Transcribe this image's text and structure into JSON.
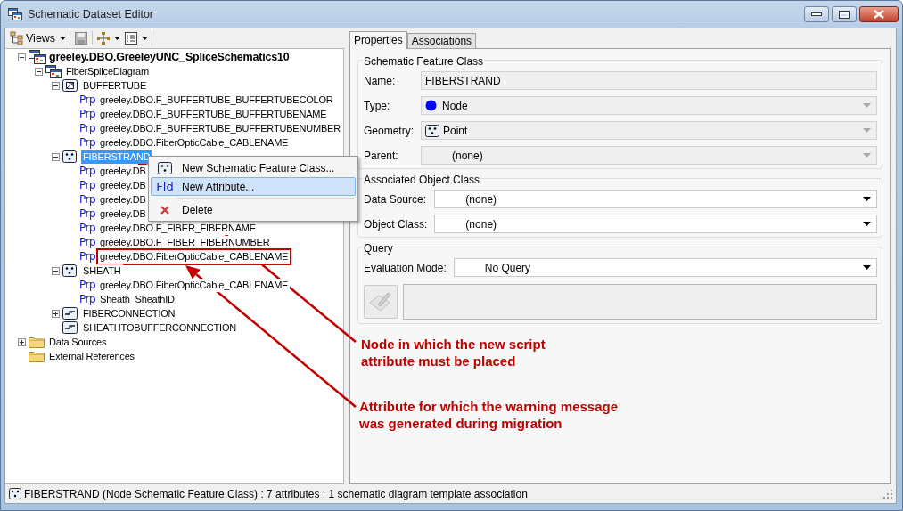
{
  "window": {
    "title": "Schematic Dataset Editor"
  },
  "toolbar": {
    "views_label": "Views"
  },
  "tree": [
    {
      "kind": "dataset",
      "label": "greeley.DBO.GreeleyUNC_SpliceSchematics10",
      "expanded": true,
      "selected": false,
      "children": [
        {
          "kind": "diagram",
          "label": "FiberSpliceDiagram",
          "expanded": true,
          "selected": false,
          "children": [
            {
              "kind": "container_class",
              "label": "BUFFERTUBE",
              "expanded": true,
              "selected": false,
              "children": [
                {
                  "kind": "property",
                  "tag": "Prp",
                  "label": "greeley.DBO.F_BUFFERTUBE_BUFFERTUBECOLOR",
                  "selected": false,
                  "outlined": false
                },
                {
                  "kind": "property",
                  "tag": "Prp",
                  "label": "greeley.DBO.F_BUFFERTUBE_BUFFERTUBENAME",
                  "selected": false,
                  "outlined": false
                },
                {
                  "kind": "property",
                  "tag": "Prp",
                  "label": "greeley.DBO.F_BUFFERTUBE_BUFFERTUBENUMBER",
                  "selected": false,
                  "outlined": false
                },
                {
                  "kind": "property",
                  "tag": "Prp",
                  "label": "greeley.DBO.FiberOpticCable_CABLENAME",
                  "selected": false,
                  "outlined": false
                }
              ]
            },
            {
              "kind": "node_class",
              "label": "FIBERSTRAND",
              "expanded": true,
              "selected": true,
              "children": [
                {
                  "kind": "property",
                  "tag": "Prp",
                  "label": "greeley.DB",
                  "selected": false,
                  "outlined": false
                },
                {
                  "kind": "property",
                  "tag": "Prp",
                  "label": "greeley.DB",
                  "selected": false,
                  "outlined": false
                },
                {
                  "kind": "property",
                  "tag": "Prp",
                  "label": "greeley.DB",
                  "selected": false,
                  "outlined": false
                },
                {
                  "kind": "property",
                  "tag": "Prp",
                  "label": "greeley.DB",
                  "selected": false,
                  "outlined": false
                },
                {
                  "kind": "property",
                  "tag": "Prp",
                  "label": "greeley.DBO.F_FIBER_FIBERNAME",
                  "selected": false,
                  "outlined": false
                },
                {
                  "kind": "property",
                  "tag": "Prp",
                  "label": "greeley.DBO.F_FIBER_FIBERNUMBER",
                  "selected": false,
                  "outlined": false
                },
                {
                  "kind": "property",
                  "tag": "Prp",
                  "label": "greeley.DBO.FiberOpticCable_CABLENAME",
                  "selected": false,
                  "outlined": true
                }
              ]
            },
            {
              "kind": "node_class",
              "label": "SHEATH",
              "expanded": true,
              "selected": false,
              "children": [
                {
                  "kind": "property",
                  "tag": "Prp",
                  "label": "greeley.DBO.FiberOpticCable_CABLENAME",
                  "selected": false,
                  "outlined": false
                },
                {
                  "kind": "property",
                  "tag": "Prp",
                  "label": "Sheath_SheathID",
                  "selected": false,
                  "outlined": false
                }
              ]
            },
            {
              "kind": "link_class",
              "label": "FIBERCONNECTION",
              "expanded": false,
              "selected": false
            },
            {
              "kind": "link_class",
              "label": "SHEATHTOBUFFERCONNECTION",
              "selected": false
            }
          ]
        }
      ]
    },
    {
      "kind": "folder",
      "label": "Data Sources",
      "expanded": false,
      "selected": false
    },
    {
      "kind": "folder",
      "label": "External References",
      "selected": false
    }
  ],
  "context_menu": {
    "items": [
      {
        "kind": "point",
        "label": "New Schematic Feature Class...",
        "selected": false
      },
      {
        "kind": "tag",
        "tag": "Fld",
        "label": "New Attribute...",
        "selected": true
      },
      {
        "kind": "separator"
      },
      {
        "kind": "delete",
        "label": "Delete",
        "selected": false
      }
    ]
  },
  "tabs": [
    {
      "label": "Properties",
      "selected": true
    },
    {
      "label": "Associations",
      "selected": false
    }
  ],
  "groups": [
    {
      "title": "Schematic Feature Class",
      "fields": [
        {
          "kind": "text",
          "label": "Name:",
          "value": "FIBERSTRAND",
          "disabled": true
        },
        {
          "kind": "combo_dot",
          "label": "Type:",
          "value": "Node",
          "disabled": true
        },
        {
          "kind": "combo_point",
          "label": "Geometry:",
          "value": "Point",
          "disabled": true
        },
        {
          "kind": "combo",
          "label": "Parent:",
          "value": "(none)",
          "disabled": true
        }
      ]
    },
    {
      "title": "Associated Object Class",
      "fields": [
        {
          "kind": "combo",
          "label": "Data Source:",
          "value": "(none)",
          "disabled": false
        },
        {
          "kind": "combo",
          "label": "Object Class:",
          "value": "(none)",
          "disabled": false
        }
      ]
    },
    {
      "title": "Query",
      "fields": [
        {
          "kind": "combo",
          "label": "Evaluation Mode:",
          "value": "No Query",
          "disabled": false
        },
        {
          "kind": "editor",
          "disabled": true
        }
      ]
    }
  ],
  "status_bar": {
    "text": "FIBERSTRAND (Node Schematic Feature Class) : 7 attributes : 1 schematic diagram template association"
  },
  "annotations": [
    {
      "lines": [
        "Node in which the new script",
        "attribute must be placed"
      ]
    },
    {
      "lines": [
        "Attribute for which the warning message",
        "was generated during migration"
      ]
    }
  ]
}
